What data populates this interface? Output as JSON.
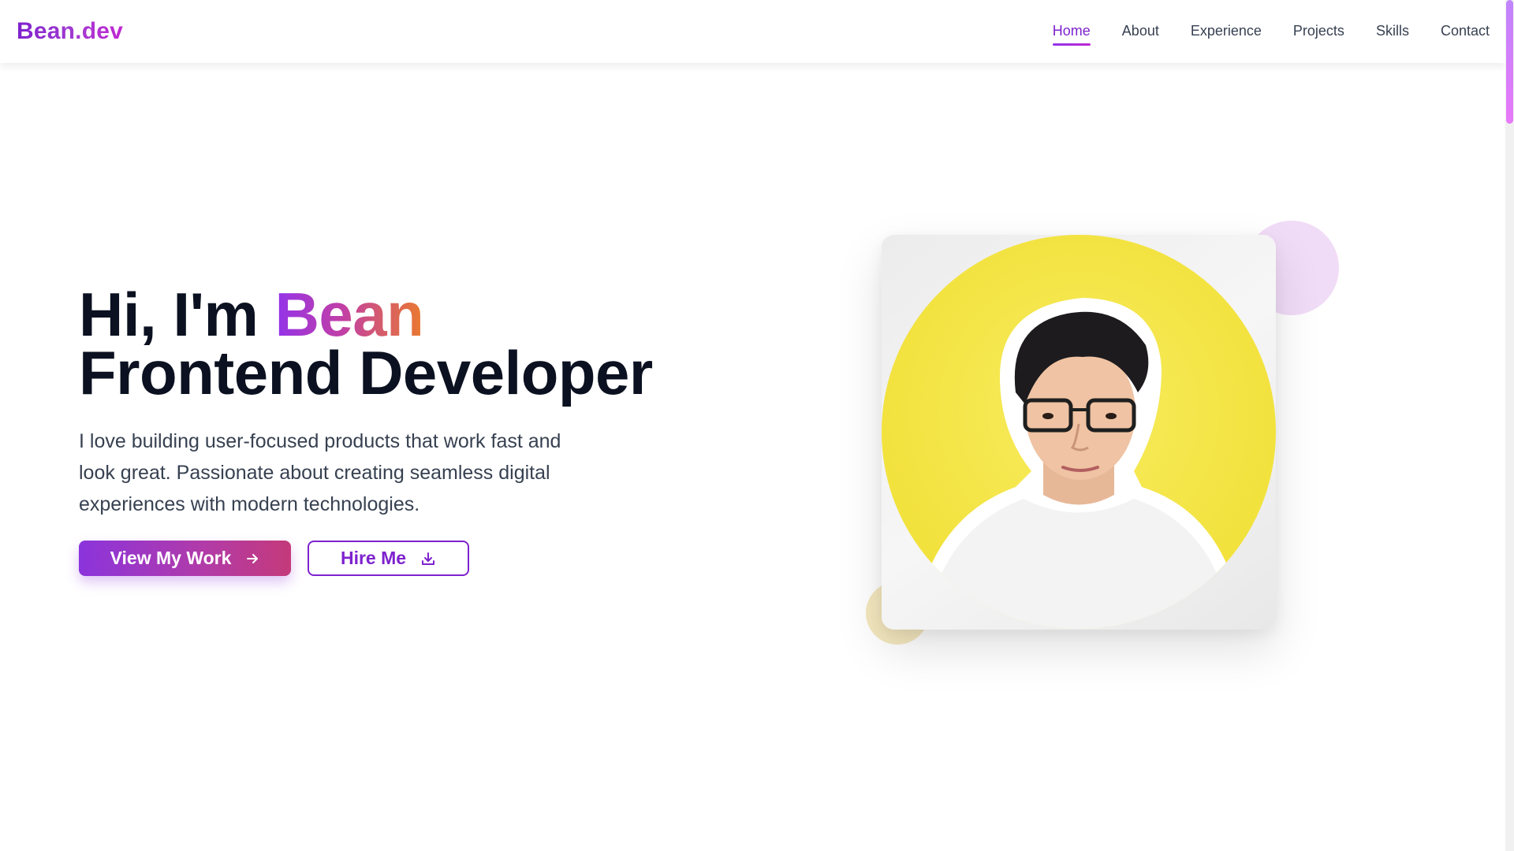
{
  "nav": {
    "logo": "Bean.dev",
    "links": [
      {
        "label": "Home",
        "active": true
      },
      {
        "label": "About",
        "active": false
      },
      {
        "label": "Experience",
        "active": false
      },
      {
        "label": "Projects",
        "active": false
      },
      {
        "label": "Skills",
        "active": false
      },
      {
        "label": "Contact",
        "active": false
      }
    ]
  },
  "hero": {
    "greeting": "Hi, I'm ",
    "name": "Bean",
    "role": "Frontend Developer",
    "description": "I love building user-focused products that work fast and look great. Passionate about creating seamless digital experiences with modern technologies.",
    "primary_button": "View My Work",
    "secondary_button": "Hire Me",
    "primary_icon": "arrow-right-icon",
    "secondary_icon": "download-icon"
  },
  "colors": {
    "accent": "#7e22ce",
    "gradient_start": "#9333ea",
    "gradient_end": "#ea7a2e",
    "portrait_background": "#f5e642"
  }
}
